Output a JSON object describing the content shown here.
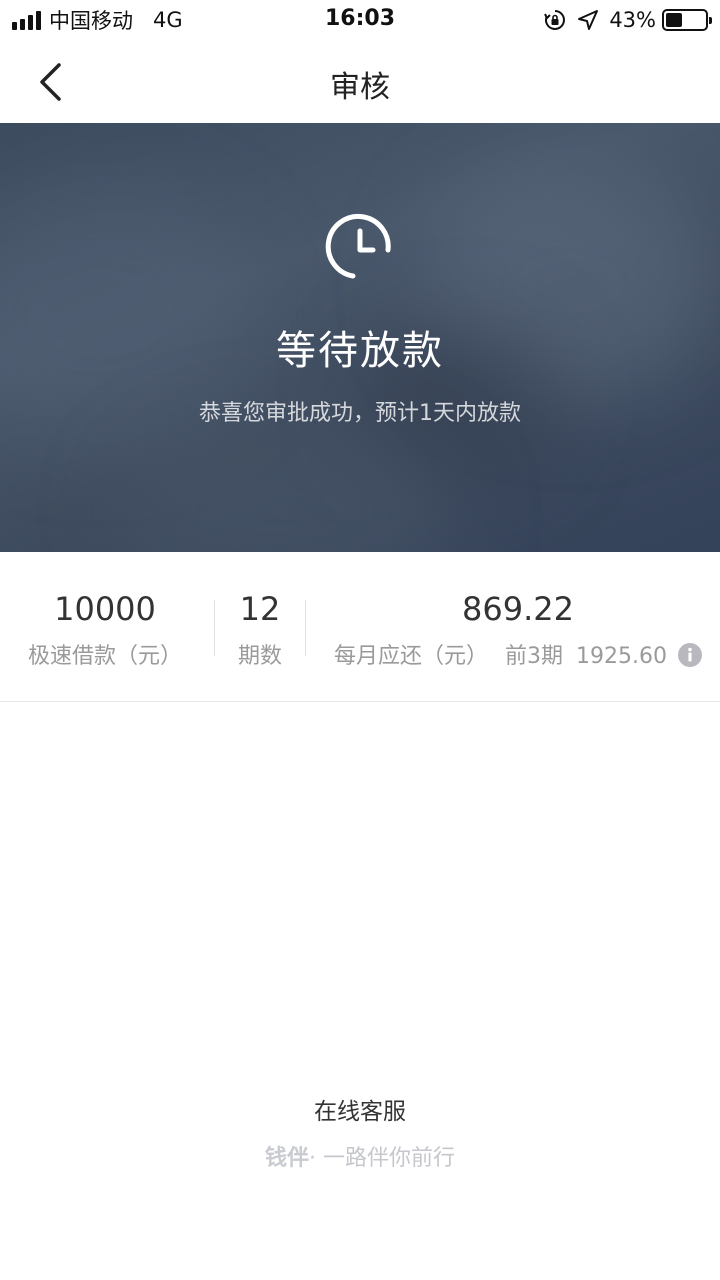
{
  "status_bar": {
    "carrier": "中国移动",
    "network": "4G",
    "time": "16:03",
    "battery_percent": "43%",
    "battery_level": 0.43
  },
  "nav": {
    "title": "审核",
    "back_icon": "chevron-left-icon"
  },
  "hero": {
    "icon": "clock-icon",
    "title": "等待放款",
    "subtitle": "恭喜您审批成功，预计1天内放款"
  },
  "loan_info": {
    "amount_value": "10000",
    "amount_label": "极速借款（元）",
    "term_value": "12",
    "term_label": "期数",
    "monthly_value": "869.22",
    "monthly_label": "每月应还（元）",
    "first_periods_label": "前3期",
    "first_periods_value": "1925.60",
    "info_icon": "info-icon"
  },
  "footer": {
    "service_label": "在线客服",
    "brand": "钱伴",
    "slogan": "· 一路伴你前行"
  },
  "colors": {
    "hero_bg": "#3f4c5f",
    "muted_text": "#9a9a9a",
    "info_icon_bg": "#b8b8be"
  }
}
